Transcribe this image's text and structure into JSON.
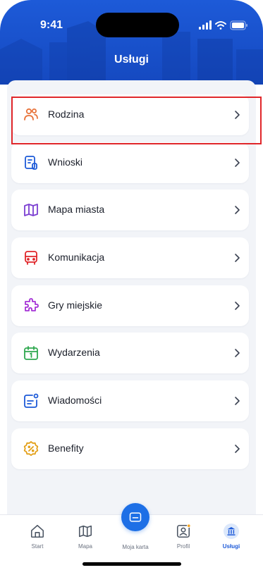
{
  "status_bar": {
    "time": "9:41"
  },
  "header": {
    "title": "Usługi"
  },
  "services": [
    {
      "label": "Rodzina",
      "icon": "family-icon",
      "color": "#e8743b"
    },
    {
      "label": "Wnioski",
      "icon": "document-icon",
      "color": "#1d5ad8"
    },
    {
      "label": "Mapa miasta",
      "icon": "map-icon",
      "color": "#7b3fd1"
    },
    {
      "label": "Komunikacja",
      "icon": "bus-icon",
      "color": "#e0262a"
    },
    {
      "label": "Gry miejskie",
      "icon": "puzzle-icon",
      "color": "#a533d6"
    },
    {
      "label": "Wydarzenia",
      "icon": "calendar-icon",
      "color": "#2fa84f"
    },
    {
      "label": "Wiadomości",
      "icon": "message-icon",
      "color": "#1d5ad8"
    },
    {
      "label": "Benefity",
      "icon": "discount-icon",
      "color": "#e3a11b"
    }
  ],
  "tabbar": {
    "tabs": [
      {
        "label": "Start",
        "icon": "home-icon"
      },
      {
        "label": "Mapa",
        "icon": "map-icon"
      },
      {
        "label": "Moja karta",
        "icon": "card-icon"
      },
      {
        "label": "Profil",
        "icon": "profile-icon"
      },
      {
        "label": "Usługi",
        "icon": "services-icon"
      }
    ],
    "active": "Usługi"
  },
  "colors": {
    "header_blue": "#1d5ad8",
    "accent_blue": "#1d6fe6",
    "highlight_red": "#e0262a",
    "content_background": "#f2f4f8"
  }
}
